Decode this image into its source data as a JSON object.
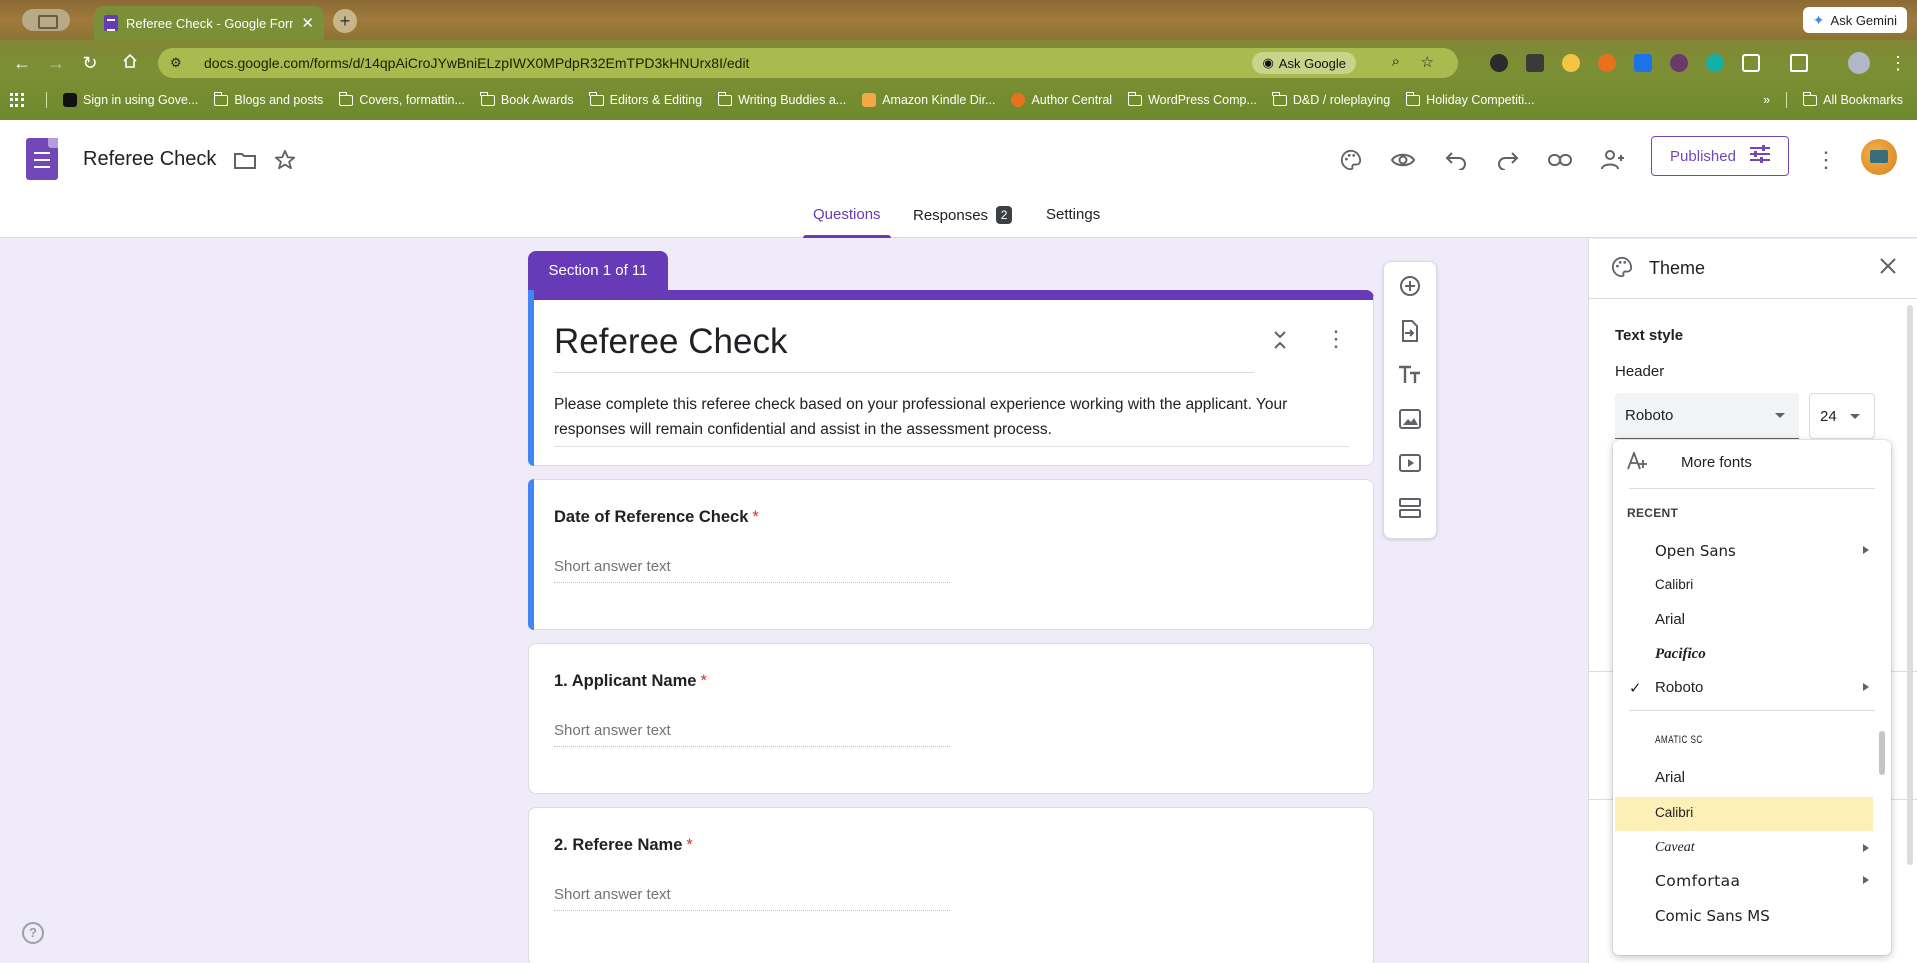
{
  "browser": {
    "tab_title": "Referee Check - Google Forms",
    "new_tab": "+",
    "ask_gemini": "Ask Gemini",
    "url": "docs.google.com/forms/d/14qpAiCroJYwBniELzpIWX0MPdpR32EmTPD3kHNUrx8I/edit",
    "ask_google": "Ask Google"
  },
  "bookmarks": [
    {
      "label": "Sign in using Gove...",
      "icon": "site"
    },
    {
      "label": "Blogs and posts",
      "icon": "folder"
    },
    {
      "label": "Covers, formattin...",
      "icon": "folder"
    },
    {
      "label": "Book Awards",
      "icon": "folder"
    },
    {
      "label": "Editors & Editing",
      "icon": "folder"
    },
    {
      "label": "Writing Buddies a...",
      "icon": "folder"
    },
    {
      "label": "Amazon Kindle Dir...",
      "icon": "amazon"
    },
    {
      "label": "Author Central",
      "icon": "author"
    },
    {
      "label": "WordPress Comp...",
      "icon": "folder"
    },
    {
      "label": "D&D / roleplaying",
      "icon": "folder"
    },
    {
      "label": "Holiday Competiti...",
      "icon": "folder"
    }
  ],
  "bookmarks_more": "»",
  "all_bookmarks": "All Bookmarks",
  "header": {
    "doc_title": "Referee Check",
    "published_label": "Published"
  },
  "tabs": {
    "questions": "Questions",
    "responses": "Responses",
    "responses_count": "2",
    "settings": "Settings"
  },
  "form": {
    "section_label": "Section 1 of 11",
    "title": "Referee Check",
    "description": "Please complete this referee check based on your professional experience working with the applicant. Your responses will remain confidential and assist in the assessment process.",
    "required_mark": "*",
    "questions": [
      {
        "title": "Date of Reference Check",
        "placeholder": "Short answer text"
      },
      {
        "title": "1. Applicant Name",
        "placeholder": "Short answer text"
      },
      {
        "title": "2. Referee Name",
        "placeholder": "Short answer text"
      }
    ]
  },
  "help": "?",
  "theme": {
    "title": "Theme",
    "text_style": "Text style",
    "header_label": "Header",
    "font_value": "Roboto",
    "size_value": "24"
  },
  "font_menu": {
    "more_fonts": "More fonts",
    "recent_label": "RECENT",
    "check": "✓",
    "recent": [
      {
        "label": "Open Sans",
        "submenu": true
      },
      {
        "label": "Calibri",
        "submenu": false
      },
      {
        "label": "Arial",
        "submenu": false
      },
      {
        "label": "Pacifico",
        "submenu": false
      },
      {
        "label": "Roboto",
        "submenu": true,
        "selected": true
      }
    ],
    "all": [
      {
        "label": "Amatic SC",
        "submenu": false
      },
      {
        "label": "Arial",
        "submenu": false
      },
      {
        "label": "Calibri",
        "submenu": false,
        "highlighted": true
      },
      {
        "label": "Caveat",
        "submenu": true
      },
      {
        "label": "Comfortaa",
        "submenu": true
      },
      {
        "label": "Comic Sans MS",
        "submenu": false
      }
    ]
  },
  "colors": {
    "primary": "#673ab7",
    "accent_blue": "#4285f4",
    "required": "#d93025",
    "highlight": "#fdefb5"
  }
}
